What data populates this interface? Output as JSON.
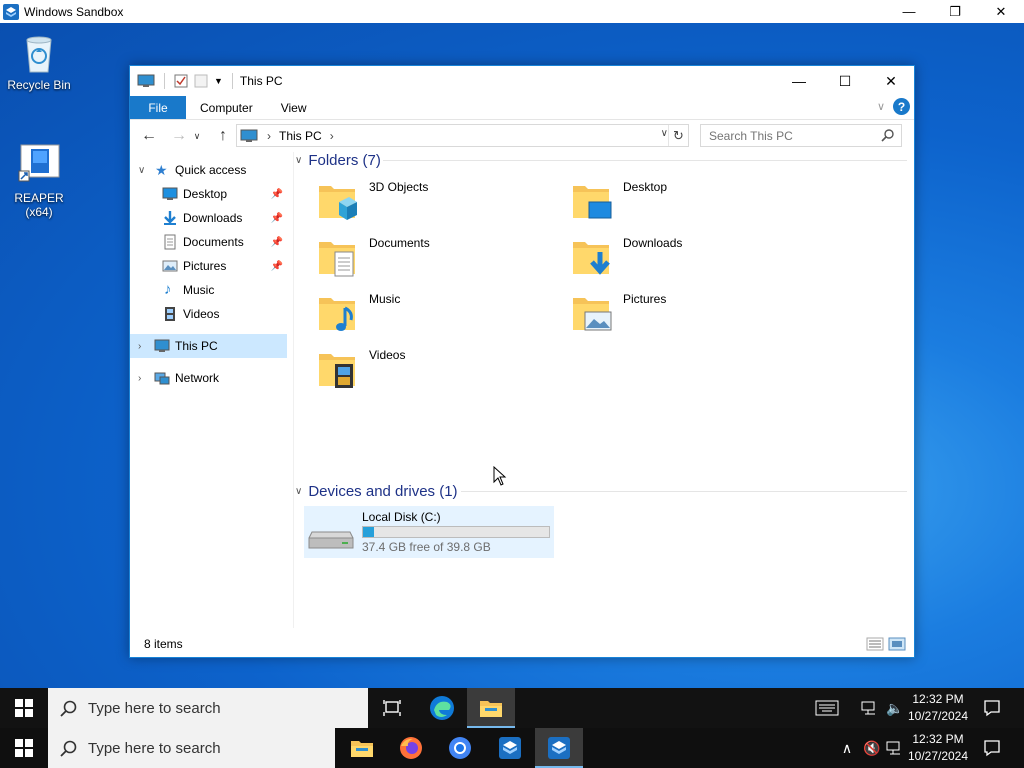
{
  "sandbox": {
    "title": "Windows Sandbox",
    "minimize_icon": "minimize-icon",
    "restore_icon": "restore-icon",
    "close_icon": "close-icon"
  },
  "desktop": {
    "icons": [
      {
        "label": "Recycle Bin",
        "icon": "recycle-bin-icon"
      },
      {
        "label": "REAPER (x64)",
        "icon": "reaper-shortcut-icon"
      }
    ]
  },
  "explorer": {
    "title": "This PC",
    "ribbon_tabs": [
      "File",
      "Computer",
      "View"
    ],
    "address": {
      "segment": "This PC"
    },
    "search": {
      "placeholder": "Search This PC"
    },
    "nav": {
      "quick_access": "Quick access",
      "quick_items": [
        "Desktop",
        "Downloads",
        "Documents",
        "Pictures",
        "Music",
        "Videos"
      ],
      "this_pc": "This PC",
      "network": "Network"
    },
    "folders_header": "Folders (7)",
    "folders": [
      {
        "name": "3D Objects",
        "icon": "3d-objects-folder-icon"
      },
      {
        "name": "Desktop",
        "icon": "desktop-folder-icon"
      },
      {
        "name": "Documents",
        "icon": "documents-folder-icon"
      },
      {
        "name": "Downloads",
        "icon": "downloads-folder-icon"
      },
      {
        "name": "Music",
        "icon": "music-folder-icon"
      },
      {
        "name": "Pictures",
        "icon": "pictures-folder-icon"
      },
      {
        "name": "Videos",
        "icon": "videos-folder-icon"
      }
    ],
    "devices_header": "Devices and drives (1)",
    "drive": {
      "name": "Local Disk (C:)",
      "free_text": "37.4 GB free of 39.8 GB",
      "used_fraction": 0.06
    },
    "status": {
      "items": "8 items"
    }
  },
  "taskbar_top": {
    "search_placeholder": "Type here to search",
    "time": "12:32 PM",
    "date": "10/27/2024"
  },
  "taskbar_bottom": {
    "search_placeholder": "Type here to search",
    "time": "12:32 PM",
    "date": "10/27/2024"
  },
  "colors": {
    "accent": "#1979ca",
    "selection": "#cce8ff",
    "drive_bar": "#26a0da",
    "header_text": "#1e3287"
  }
}
